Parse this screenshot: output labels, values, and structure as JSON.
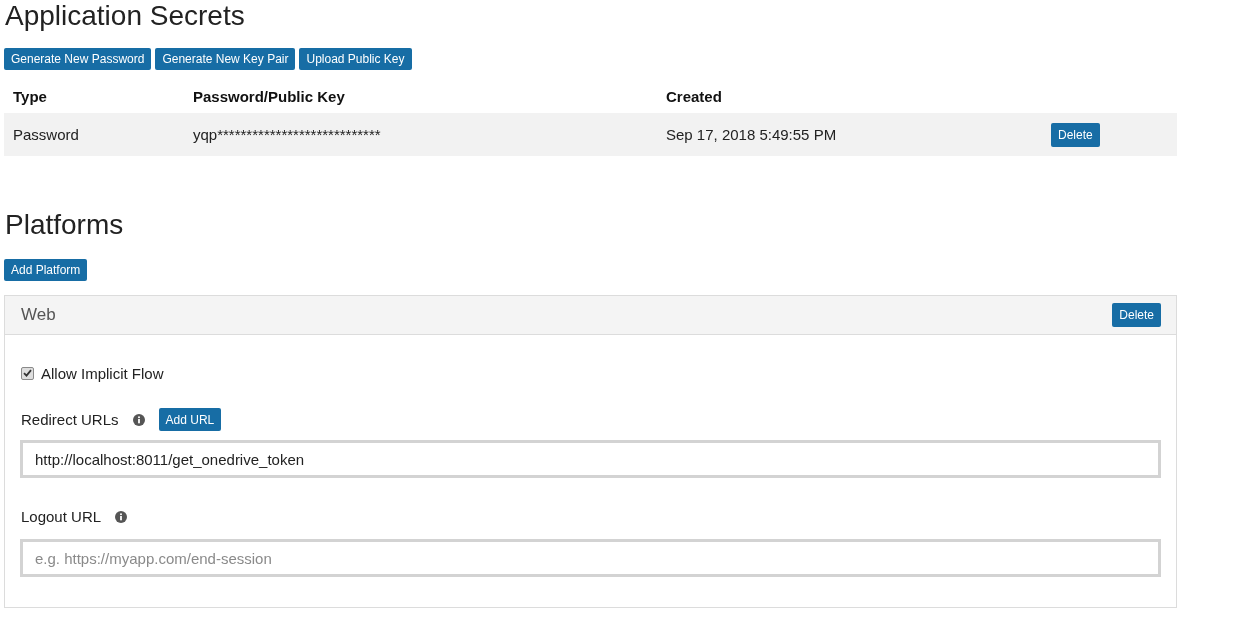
{
  "secrets": {
    "title": "Application Secrets",
    "buttons": [
      "Generate New Password",
      "Generate New Key Pair",
      "Upload Public Key"
    ],
    "table": {
      "columns": [
        "Type",
        "Password/Public Key",
        "Created"
      ],
      "rows": [
        {
          "type": "Password",
          "key": "yqp****************************",
          "created": "Sep 17, 2018 5:49:55 PM",
          "action": "Delete"
        }
      ]
    }
  },
  "platforms": {
    "title": "Platforms",
    "add_button": "Add Platform",
    "items": [
      {
        "name": "Web",
        "delete_button": "Delete",
        "implicit_flow": {
          "label": "Allow Implicit Flow",
          "checked": true
        },
        "redirect": {
          "label": "Redirect URLs",
          "add_button": "Add URL",
          "value": "http://localhost:8011/get_onedrive_token"
        },
        "logout": {
          "label": "Logout URL",
          "placeholder": "e.g. https://myapp.com/end-session"
        }
      }
    ]
  }
}
